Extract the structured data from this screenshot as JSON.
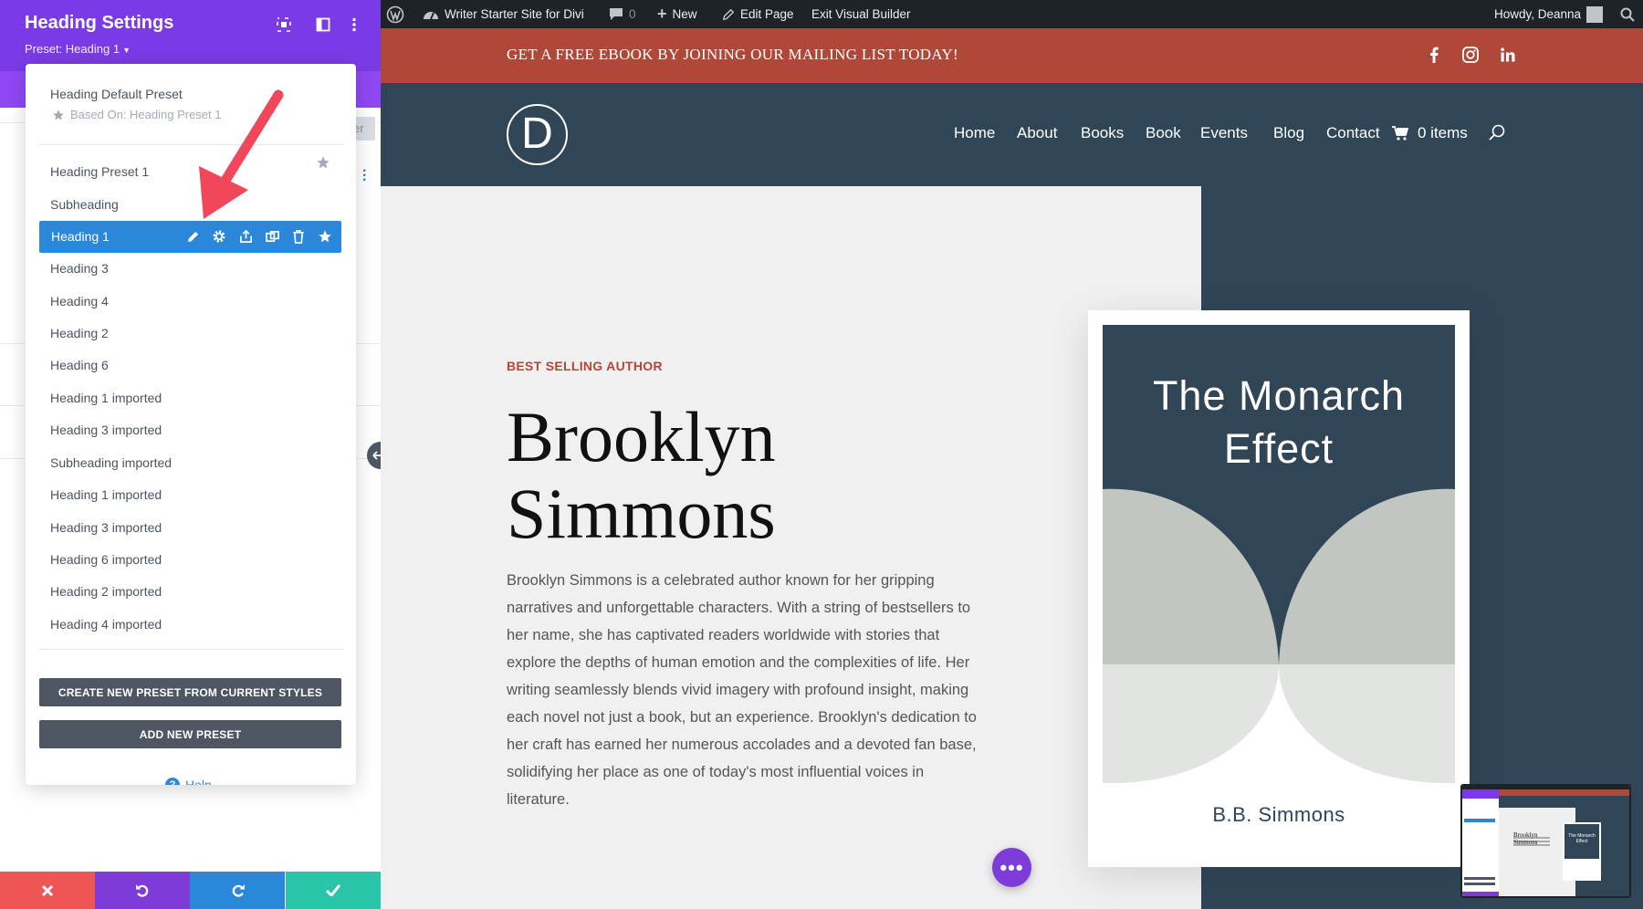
{
  "panel": {
    "title": "Heading Settings",
    "preset_label": "Preset: Heading 1",
    "bg_chip": "er",
    "dropdown": {
      "default_preset": "Heading Default Preset",
      "based_on": "Based On: Heading Preset 1",
      "items": [
        "Heading Preset 1",
        "Subheading",
        "Heading 1",
        "Heading 3",
        "Heading 4",
        "Heading 2",
        "Heading 6",
        "Heading 1 imported",
        "Heading 3 imported",
        "Subheading imported",
        "Heading 1 imported",
        "Heading 3 imported",
        "Heading 6 imported",
        "Heading 2 imported",
        "Heading 4 imported"
      ],
      "active_index": 2,
      "create_button": "CREATE NEW PRESET FROM CURRENT STYLES",
      "add_button": "ADD NEW PRESET",
      "help": "Help"
    },
    "footer_colors": {
      "discard": "#ef5555",
      "undo": "#7d3bd9",
      "redo": "#2b87da",
      "save": "#29c4a9"
    }
  },
  "adminbar": {
    "site_name": "Writer Starter Site for Divi",
    "comments": "0",
    "new": "New",
    "edit_page": "Edit Page",
    "exit_builder": "Exit Visual Builder",
    "howdy": "Howdy, Deanna"
  },
  "site": {
    "topbar": "GET A FREE EBOOK BY JOINING OUR MAILING LIST TODAY!",
    "logo_letter": "D",
    "nav": [
      "Home",
      "About",
      "Books",
      "Book",
      "Events",
      "Blog",
      "Contact"
    ],
    "cart": "0 items",
    "eyebrow": "BEST SELLING AUTHOR",
    "hero_title_line1": "Brooklyn",
    "hero_title_line2": "Simmons",
    "hero_text": "Brooklyn Simmons is a celebrated author known for her gripping narratives and unforgettable characters. With a string of bestsellers to her name, she has captivated readers worldwide with stories that explore the depths of human emotion and the complexities of life. Her writing seamlessly blends vivid imagery with profound insight, making each novel not just a book, but an experience. Brooklyn's dedication to her craft has earned her numerous accolades and a devoted fan base, solidifying her place as one of today's most influential voices in literature.",
    "book_title_line1": "The Monarch",
    "book_title_line2": "Effect",
    "book_author": "B.B. Simmons",
    "thumb_title_line1": "Brooklyn",
    "thumb_title_line2": "Simmons",
    "thumb_book_line1": "The Monarch",
    "thumb_book_line2": "Effect"
  },
  "colors": {
    "accent_purple": "#7a3be6",
    "active_blue": "#2b87da",
    "brand_red": "#b0483a",
    "navy": "#304657",
    "annotation_arrow": "#f0475a"
  }
}
